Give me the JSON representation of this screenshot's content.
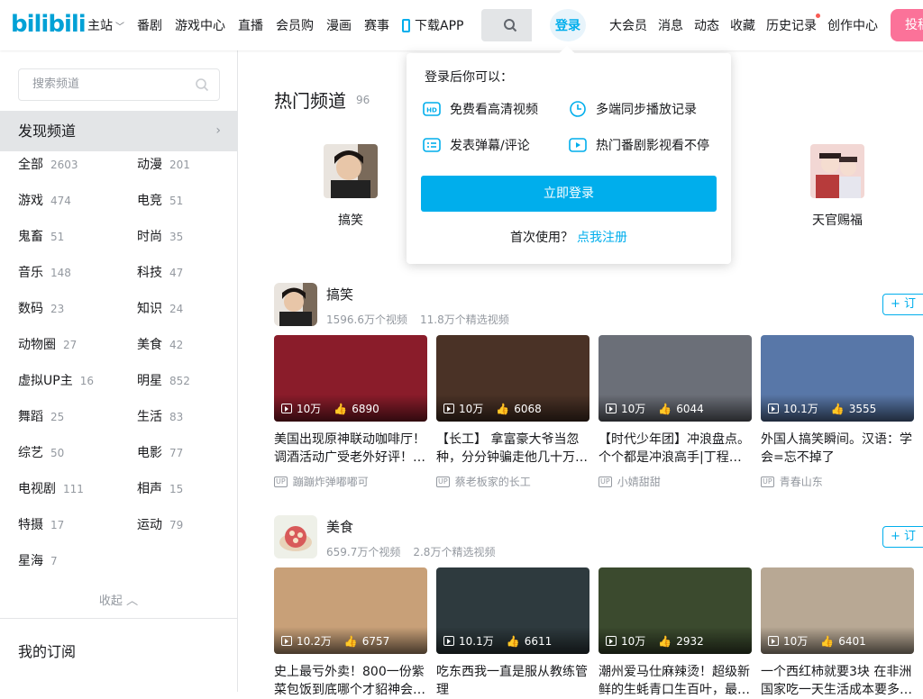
{
  "header": {
    "logo": "bilibili",
    "nav": [
      {
        "label": "主站",
        "dropdown": true
      },
      {
        "label": "番剧"
      },
      {
        "label": "游戏中心"
      },
      {
        "label": "直播"
      },
      {
        "label": "会员购"
      },
      {
        "label": "漫画"
      },
      {
        "label": "赛事"
      },
      {
        "label": "下载APP"
      }
    ],
    "login": "登录",
    "right_nav": [
      "大会员",
      "消息",
      "动态",
      "收藏",
      "历史记录",
      "创作中心"
    ],
    "upload": "投稿",
    "accent": "#00aeec",
    "pink": "#fb7299"
  },
  "sidebar": {
    "search_placeholder": "搜索频道",
    "discover": "发现频道",
    "categories": [
      {
        "name": "全部",
        "count": "2603"
      },
      {
        "name": "动漫",
        "count": "201"
      },
      {
        "name": "游戏",
        "count": "474"
      },
      {
        "name": "电竞",
        "count": "51"
      },
      {
        "name": "鬼畜",
        "count": "51"
      },
      {
        "name": "时尚",
        "count": "35"
      },
      {
        "name": "音乐",
        "count": "148"
      },
      {
        "name": "科技",
        "count": "47"
      },
      {
        "name": "数码",
        "count": "23"
      },
      {
        "name": "知识",
        "count": "24"
      },
      {
        "name": "动物圈",
        "count": "27"
      },
      {
        "name": "美食",
        "count": "42"
      },
      {
        "name": "虚拟UP主",
        "count": "16"
      },
      {
        "name": "明星",
        "count": "852"
      },
      {
        "name": "舞蹈",
        "count": "25"
      },
      {
        "name": "生活",
        "count": "83"
      },
      {
        "name": "综艺",
        "count": "50"
      },
      {
        "name": "电影",
        "count": "77"
      },
      {
        "name": "电视剧",
        "count": "111"
      },
      {
        "name": "相声",
        "count": "15"
      },
      {
        "name": "特摄",
        "count": "17"
      },
      {
        "name": "运动",
        "count": "79"
      },
      {
        "name": "星海",
        "count": "7"
      }
    ],
    "collapse": "收起",
    "subscriptions": "我的订阅"
  },
  "main": {
    "hot_title": "热门频道",
    "hot_count": "96",
    "hot_channels": [
      "搞笑",
      "天官赐福"
    ],
    "channels": [
      {
        "name": "搞笑",
        "views": "1596.6万个视频",
        "featured": "11.8万个精选视频",
        "subscribe": "+ 订",
        "videos": [
          {
            "title": "美国出现原神联动咖啡厅！调酒活动广受老外好评！…",
            "plays": "10万",
            "likes": "6890",
            "uploader": "蹦蹦炸弹嘟嘟可",
            "color": "#8a1c2a"
          },
          {
            "title": "【长工】 拿富豪大爷当忽种，分分钟骗走他几十万…",
            "plays": "10万",
            "likes": "6068",
            "uploader": "蔡老板家的长工",
            "color": "#4a3226"
          },
          {
            "title": "【时代少年团】冲浪盘点。个个都是冲浪高手|丁程…",
            "plays": "10万",
            "likes": "6044",
            "uploader": "小婧甜甜",
            "color": "#6b6f78"
          },
          {
            "title": "外国人搞笑瞬间。汉语：学会=忘不掉了",
            "plays": "10.1万",
            "likes": "3555",
            "uploader": "青春山东",
            "color": "#5877a8"
          }
        ]
      },
      {
        "name": "美食",
        "views": "659.7万个视频",
        "featured": "2.8万个精选视频",
        "subscribe": "+ 订",
        "videos": [
          {
            "title": "史上最亏外卖！800一份紫菜包饭到底哪个才貂神会…",
            "plays": "10.2万",
            "likes": "6757",
            "uploader": "",
            "color": "#c8a078"
          },
          {
            "title": "吃东西我一直是服从教练管理",
            "plays": "10.1万",
            "likes": "6611",
            "uploader": "",
            "color": "#2e3a3e"
          },
          {
            "title": "潮州爱马仕麻辣烫！超级新鲜的生蚝青口生百叶，最…",
            "plays": "10万",
            "likes": "2932",
            "uploader": "",
            "color": "#3b4a2e"
          },
          {
            "title": "一个西红柿就要3块 在非洲国家吃一天生活成本要多…",
            "plays": "10万",
            "likes": "6401",
            "uploader": "",
            "color": "#b8a894"
          }
        ]
      }
    ]
  },
  "popover": {
    "title": "登录后你可以：",
    "features": [
      "免费看高清视频",
      "多端同步播放记录",
      "发表弹幕/评论",
      "热门番剧影视看不停"
    ],
    "button": "立即登录",
    "first_use": "首次使用？",
    "register": "点我注册"
  }
}
